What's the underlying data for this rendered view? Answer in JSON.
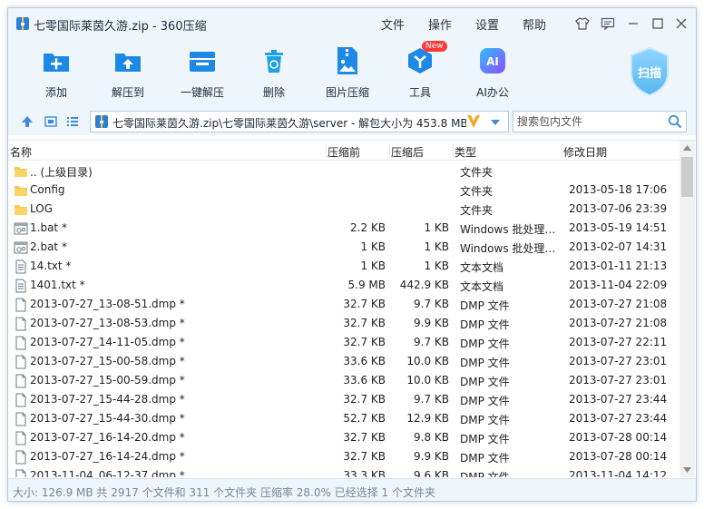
{
  "window": {
    "title": "七零国际莱茵久游.zip - 360压缩",
    "menu": [
      "文件",
      "操作",
      "设置",
      "帮助"
    ]
  },
  "toolbar": {
    "buttons": [
      {
        "label": "添加",
        "icon": "add-icon"
      },
      {
        "label": "解压到",
        "icon": "extract-to-icon"
      },
      {
        "label": "一键解压",
        "icon": "one-click-extract-icon"
      },
      {
        "label": "删除",
        "icon": "trash-icon"
      },
      {
        "label": "图片压缩",
        "icon": "image-compress-icon"
      },
      {
        "label": "工具",
        "icon": "tools-icon",
        "badge": "New"
      },
      {
        "label": "AI办公",
        "icon": "ai-office-icon",
        "icon_text": "AI"
      }
    ],
    "scan_label": "扫描"
  },
  "address": {
    "path": "七零国际莱茵久游.zip\\七零国际莱茵久游\\server - 解包大小为 453.8 MB",
    "search_placeholder": "搜索包内文件"
  },
  "columns": {
    "name": "名称",
    "compressed": "压缩前",
    "uncompressed": "压缩后",
    "type": "类型",
    "date": "修改日期"
  },
  "files": [
    {
      "name": ".. (上级目录)",
      "compressed": "",
      "uncompressed": "",
      "type": "文件夹",
      "date": "",
      "icon": "folder-icon"
    },
    {
      "name": "Config",
      "compressed": "",
      "uncompressed": "",
      "type": "文件夹",
      "date": "2013-05-18 17:06",
      "icon": "folder-icon"
    },
    {
      "name": "LOG",
      "compressed": "",
      "uncompressed": "",
      "type": "文件夹",
      "date": "2013-07-06 23:39",
      "icon": "folder-icon"
    },
    {
      "name": "1.bat *",
      "compressed": "2.2 KB",
      "uncompressed": "1 KB",
      "type": "Windows 批处理文件",
      "date": "2013-05-19 14:51",
      "icon": "batch-file-icon"
    },
    {
      "name": "2.bat *",
      "compressed": "1 KB",
      "uncompressed": "1 KB",
      "type": "Windows 批处理文件",
      "date": "2013-02-07 14:31",
      "icon": "batch-file-icon"
    },
    {
      "name": "14.txt *",
      "compressed": "1 KB",
      "uncompressed": "1 KB",
      "type": "文本文档",
      "date": "2013-01-11 21:13",
      "icon": "text-file-icon"
    },
    {
      "name": "1401.txt *",
      "compressed": "5.9 MB",
      "uncompressed": "442.9 KB",
      "type": "文本文档",
      "date": "2013-11-04 22:09",
      "icon": "text-file-icon"
    },
    {
      "name": "2013-07-27_13-08-51.dmp *",
      "compressed": "32.7 KB",
      "uncompressed": "9.7 KB",
      "type": "DMP 文件",
      "date": "2013-07-27 21:08",
      "icon": "file-icon"
    },
    {
      "name": "2013-07-27_13-08-53.dmp *",
      "compressed": "32.7 KB",
      "uncompressed": "9.9 KB",
      "type": "DMP 文件",
      "date": "2013-07-27 21:08",
      "icon": "file-icon"
    },
    {
      "name": "2013-07-27_14-11-05.dmp *",
      "compressed": "32.7 KB",
      "uncompressed": "9.7 KB",
      "type": "DMP 文件",
      "date": "2013-07-27 22:11",
      "icon": "file-icon"
    },
    {
      "name": "2013-07-27_15-00-58.dmp *",
      "compressed": "33.6 KB",
      "uncompressed": "10.0 KB",
      "type": "DMP 文件",
      "date": "2013-07-27 23:01",
      "icon": "file-icon"
    },
    {
      "name": "2013-07-27_15-00-59.dmp *",
      "compressed": "33.6 KB",
      "uncompressed": "10.0 KB",
      "type": "DMP 文件",
      "date": "2013-07-27 23:01",
      "icon": "file-icon"
    },
    {
      "name": "2013-07-27_15-44-28.dmp *",
      "compressed": "32.7 KB",
      "uncompressed": "9.7 KB",
      "type": "DMP 文件",
      "date": "2013-07-27 23:44",
      "icon": "file-icon"
    },
    {
      "name": "2013-07-27_15-44-30.dmp *",
      "compressed": "52.7 KB",
      "uncompressed": "12.9 KB",
      "type": "DMP 文件",
      "date": "2013-07-27 23:44",
      "icon": "file-icon"
    },
    {
      "name": "2013-07-27_16-14-20.dmp *",
      "compressed": "32.7 KB",
      "uncompressed": "9.8 KB",
      "type": "DMP 文件",
      "date": "2013-07-28 00:14",
      "icon": "file-icon"
    },
    {
      "name": "2013-07-27_16-14-24.dmp *",
      "compressed": "32.7 KB",
      "uncompressed": "9.9 KB",
      "type": "DMP 文件",
      "date": "2013-07-28 00:14",
      "icon": "file-icon"
    },
    {
      "name": "2013-11-04_06-12-37.dmp *",
      "compressed": "33.3 KB",
      "uncompressed": "9.6 KB",
      "type": "DMP 文件",
      "date": "2013-11-04 14:12",
      "icon": "file-icon"
    }
  ],
  "status": {
    "text": "大小: 126.9 MB 共 2917 个文件和 311 个文件夹 压缩率 28.0% 已经选择 1 个文件夹"
  },
  "colors": {
    "toolbar_bg": "#eef5fb",
    "icon_blue": "#1e88e5",
    "folder_yellow": "#f5c84c",
    "badge_red": "#ff3a3a"
  }
}
